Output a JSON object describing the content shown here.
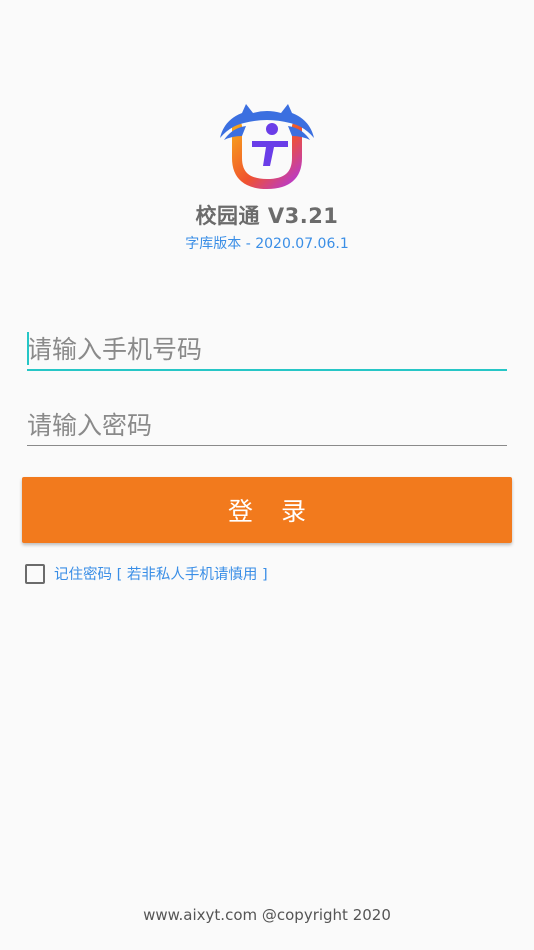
{
  "app": {
    "title": "校园通 V3.21",
    "version": "字库版本 - 2020.07.06.1"
  },
  "login_form": {
    "phone_placeholder": "请输入手机号码",
    "password_placeholder": "请输入密码",
    "login_label": "登 录",
    "remember_label": "记住密码 [ 若非私人手机请慎用 ]",
    "remember_checked": false
  },
  "footer": {
    "text": "www.aixyt.com @copyright 2020"
  },
  "colors": {
    "accent_orange": "#f27a1d",
    "link_blue": "#3a8ee6",
    "focus_teal": "#26c6c6",
    "logo_blue": "#3b6fe0",
    "logo_purple": "#6a3de8"
  },
  "icons": {
    "logo": "app-logo-icon",
    "checkbox": "checkbox-icon"
  }
}
